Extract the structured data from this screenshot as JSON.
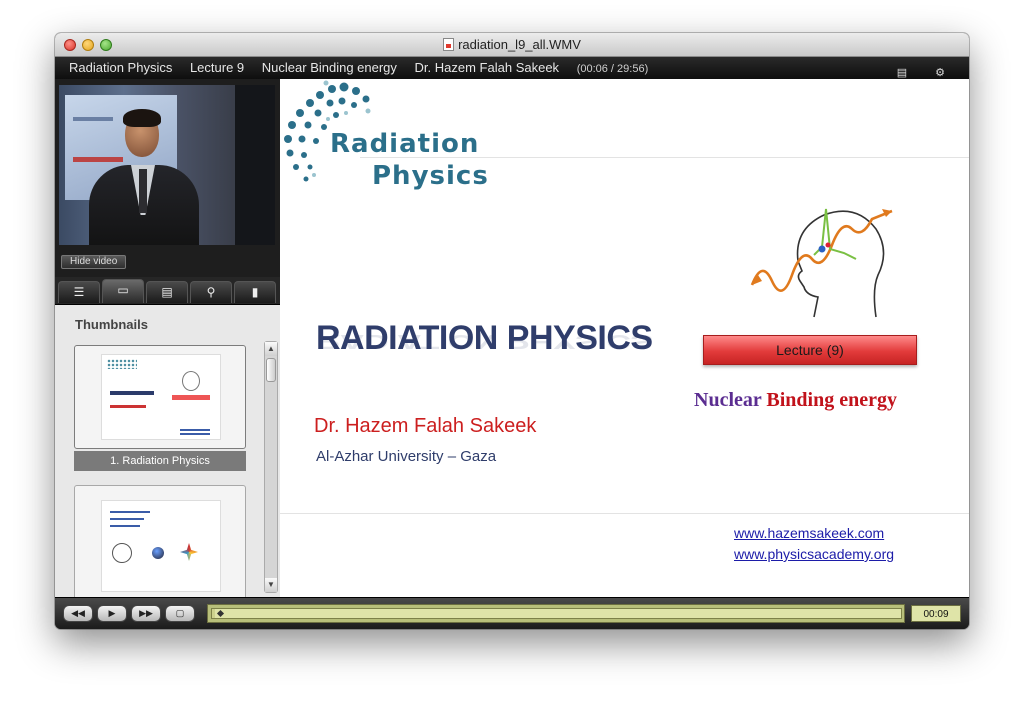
{
  "window": {
    "title": "radiation_l9_all.WMV"
  },
  "infobar": {
    "course": "Radiation Physics",
    "lecture": "Lecture 9",
    "topic": "Nuclear Binding energy",
    "presenter": "Dr. Hazem Falah Sakeek",
    "time": "(00:06 / 29:56)",
    "icons": [
      "speech-bubble-icon",
      "signal-icon"
    ]
  },
  "sidebar": {
    "hide_video_label": "Hide video",
    "tabs": [
      {
        "icon": "list-icon"
      },
      {
        "icon": "slide-icon"
      },
      {
        "icon": "notes-icon"
      },
      {
        "icon": "search-icon"
      },
      {
        "icon": "attachment-icon"
      }
    ],
    "thumbnails_heading": "Thumbnails",
    "thumbnails": [
      {
        "caption": "1. Radiation Physics"
      }
    ]
  },
  "slide": {
    "logo_line1": "Radiation",
    "logo_line2": "Physics",
    "main_title": "RADIATION PHYSICS",
    "author": "Dr. Hazem Falah Sakeek",
    "affiliation": "Al-Azhar University – Gaza",
    "lecture_label": "Lecture (9)",
    "subject_part1": "Nuclear",
    "subject_part2": "Binding energy",
    "links": [
      "www.hazemsakeek.com",
      "www.physicsacademy.org"
    ]
  },
  "controls": {
    "rewind_label": "◀◀",
    "play_label": "▶",
    "forward_label": "▶▶",
    "fullscreen_label": "▢",
    "elapsed": "00:09",
    "progress_fraction": 0.005
  }
}
